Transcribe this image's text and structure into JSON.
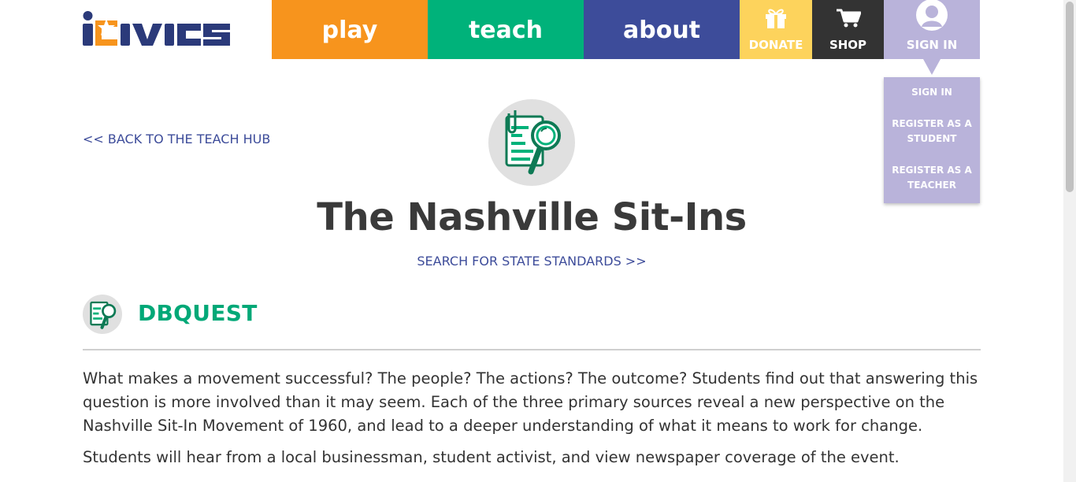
{
  "logo": {
    "text": "iCivics"
  },
  "nav": {
    "play": "play",
    "teach": "teach",
    "about": "about",
    "donate": "DONATE",
    "shop": "SHOP",
    "signin": "SIGN IN"
  },
  "dropdown": {
    "items": [
      "SIGN IN",
      "REGISTER AS A STUDENT",
      "REGISTER AS A TEACHER"
    ]
  },
  "back_link": "<< BACK TO THE TEACH HUB",
  "title": "The Nashville Sit-Ins",
  "standards_link": "SEARCH FOR STATE STANDARDS >>",
  "section": {
    "title": "DBQUEST"
  },
  "paragraphs": [
    "What makes a movement successful? The people? The actions? The outcome? Students find out that answering this question is more involved than it may seem. Each of the three primary sources reveal a new perspective on the Nashville Sit-In Movement of 1960, and lead to a deeper understanding of what it means to work for change.",
    "Students will hear from a local businessman, student activist, and view newspaper coverage of the event."
  ],
  "colors": {
    "play": "#f7941d",
    "teach": "#00b27a",
    "about": "#3d4c9a",
    "donate": "#fdd35c",
    "shop": "#333333",
    "signin": "#b9b3da",
    "link": "#3d4c9a",
    "section_title": "#00a877"
  },
  "icons": [
    "gift-icon",
    "cart-icon",
    "user-avatar-icon",
    "document-magnifier-icon"
  ]
}
